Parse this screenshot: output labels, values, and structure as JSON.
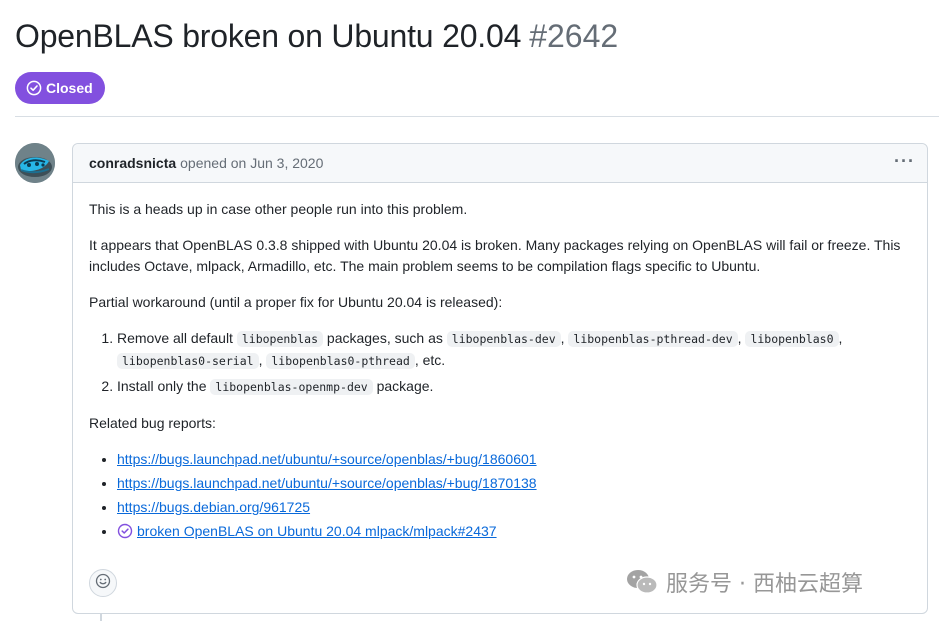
{
  "issue": {
    "title": "OpenBLAS broken on Ubuntu 20.04",
    "number": "#2642",
    "state_label": "Closed",
    "state_color": "#8250df"
  },
  "comment": {
    "author": "conradsnicta",
    "opened_text": "opened on Jun 3, 2020",
    "paragraph1": "This is a heads up in case other people run into this problem.",
    "paragraph2": "It appears that OpenBLAS 0.3.8 shipped with Ubuntu 20.04 is broken. Many packages relying on OpenBLAS will fail or freeze. This includes Octave, mlpack, Armadillo, etc. The main problem seems to be compilation flags specific to Ubuntu.",
    "paragraph3": "Partial workaround (until a proper fix for Ubuntu 20.04 is released):",
    "step1": {
      "prefix": "Remove all default",
      "code1": "libopenblas",
      "middle": "packages, such as",
      "code2": "libopenblas-dev",
      "code3": "libopenblas-pthread-dev",
      "code4": "libopenblas0",
      "code5": "libopenblas0-serial",
      "code6": "libopenblas0-pthread",
      "suffix": ", etc.",
      "sep": ","
    },
    "step2": {
      "prefix": "Install only the",
      "code": "libopenblas-openmp-dev",
      "suffix": "package."
    },
    "related_heading": "Related bug reports:",
    "links": [
      "https://bugs.launchpad.net/ubuntu/+source/openblas/+bug/1860601",
      "https://bugs.launchpad.net/ubuntu/+source/openblas/+bug/1870138",
      "https://bugs.debian.org/961725",
      "broken OpenBLAS on Ubuntu 20.04 mlpack/mlpack#2437"
    ]
  },
  "icons": {
    "state": "check-circle-icon",
    "kebab": "kebab-horizontal-icon",
    "reaction": "smiley-icon",
    "issue_ref": "issue-closed-icon",
    "watermark": "wechat-icon"
  },
  "watermark": {
    "text": "服务号 · 西柚云超算"
  }
}
